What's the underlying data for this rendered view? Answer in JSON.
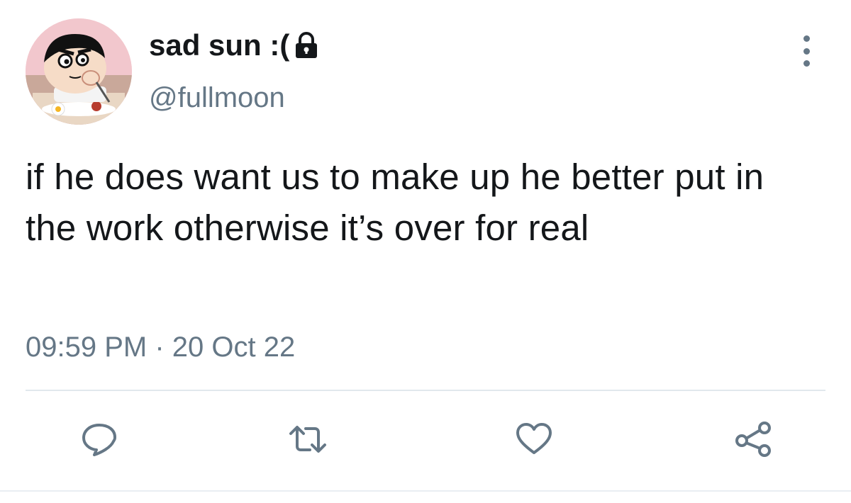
{
  "tweet": {
    "author": {
      "display_name": "sad sun :(",
      "handle": "@fullmoon",
      "protected_icon": "lock-icon",
      "avatar_icon": "cartoon-avatar"
    },
    "text": "if he does want us to make up he better put in the work otherwise it’s over for real",
    "timestamp": "09:59 PM · 20 Oct 22",
    "menu_icon": "more-vertical-icon",
    "actions": [
      {
        "name": "reply",
        "icon": "reply-icon"
      },
      {
        "name": "retweet",
        "icon": "retweet-icon"
      },
      {
        "name": "like",
        "icon": "heart-icon"
      },
      {
        "name": "share",
        "icon": "share-icon"
      }
    ]
  },
  "colors": {
    "text_primary": "#14171a",
    "text_secondary": "#657786",
    "divider": "#e1e8ed"
  }
}
